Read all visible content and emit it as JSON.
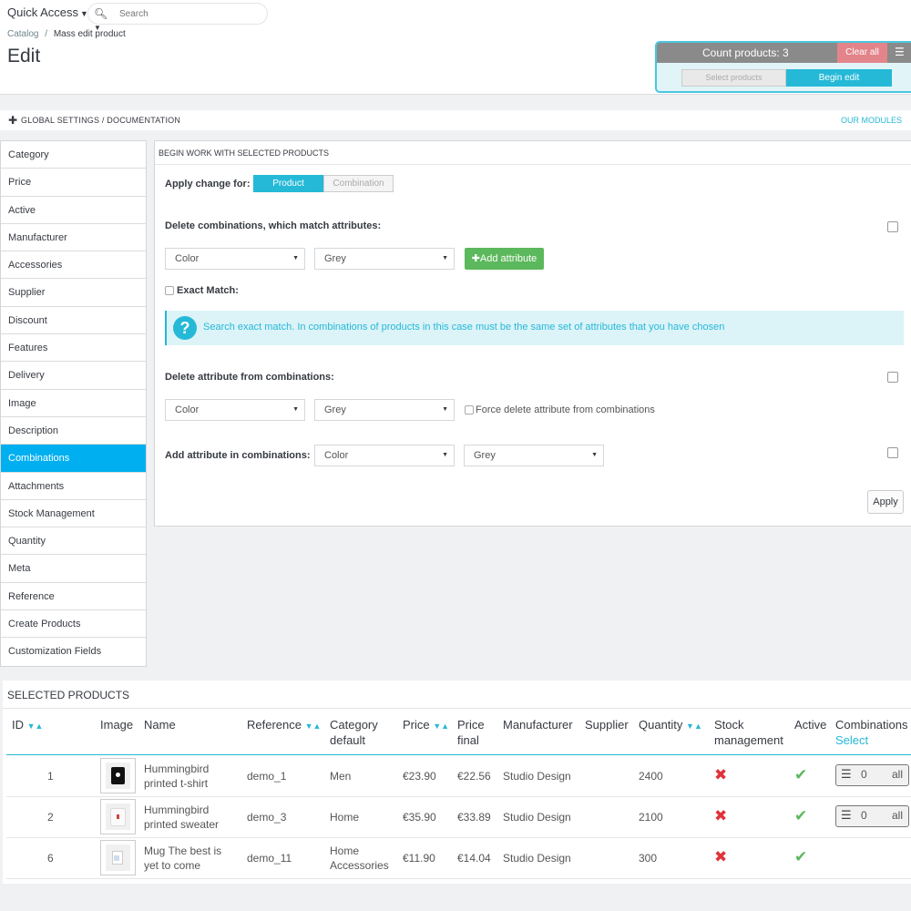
{
  "header": {
    "quick_access": "Quick Access",
    "search_placeholder": "Search",
    "breadcrumb": {
      "catalog": "Catalog",
      "sep": "/",
      "current": "Mass edit product"
    },
    "title": "Edit"
  },
  "count_panel": {
    "count_text": "Count products: 3",
    "clear_all": "Clear all",
    "select_products": "Select products",
    "begin_edit": "Begin edit"
  },
  "global_bar": {
    "label": "GLOBAL SETTINGS / DOCUMENTATION",
    "modules_link": "OUR MODULES"
  },
  "sidebar": {
    "items": [
      {
        "label": "Category"
      },
      {
        "label": "Price"
      },
      {
        "label": "Active"
      },
      {
        "label": "Manufacturer"
      },
      {
        "label": "Accessories"
      },
      {
        "label": "Supplier"
      },
      {
        "label": "Discount"
      },
      {
        "label": "Features"
      },
      {
        "label": "Delivery"
      },
      {
        "label": "Image"
      },
      {
        "label": "Description"
      },
      {
        "label": "Combinations"
      },
      {
        "label": "Attachments"
      },
      {
        "label": "Stock Management"
      },
      {
        "label": "Quantity"
      },
      {
        "label": "Meta"
      },
      {
        "label": "Reference"
      },
      {
        "label": "Create Products"
      },
      {
        "label": "Customization Fields"
      }
    ],
    "active": "Combinations"
  },
  "main": {
    "heading": "BEGIN WORK WITH SELECTED PRODUCTS",
    "apply_change_for": "Apply change for:",
    "toggle_product": "Product",
    "toggle_combination": "Combination",
    "delete_comb_label": "Delete combinations, which match attributes:",
    "select_attr_1": "Color",
    "select_val_1": "Grey",
    "add_attribute": "Add attribute",
    "exact_match": "Exact Match:",
    "info_text": "Search exact match. In combinations of products in this case must be the same set of attributes that you have chosen",
    "delete_attr_label": "Delete attribute from combinations:",
    "select_attr_2": "Color",
    "select_val_2": "Grey",
    "force_delete": "Force delete attribute from combinations",
    "add_attr_label": "Add attribute in combinations:",
    "select_attr_3": "Color",
    "select_val_3": "Grey",
    "apply": "Apply"
  },
  "selected_products": {
    "title": "SELECTED PRODUCTS",
    "columns": {
      "id": "ID",
      "image": "Image",
      "name": "Name",
      "reference": "Reference",
      "category_1": "Category",
      "category_2": "default",
      "price": "Price",
      "price_final_1": "Price",
      "price_final_2": "final",
      "manufacturer": "Manufacturer",
      "supplier": "Supplier",
      "quantity": "Quantity",
      "stock_1": "Stock",
      "stock_2": "management",
      "active": "Active",
      "combinations": "Combinations",
      "combinations_select": "Select"
    },
    "rows": [
      {
        "id": "1",
        "name_1": "Hummingbird",
        "name_2": "printed t-shirt",
        "reference": "demo_1",
        "category_1": "Men",
        "category_2": "",
        "price": "€23.90",
        "price_final": "€22.56",
        "manufacturer": "Studio Design",
        "quantity": "2400",
        "stock_management": false,
        "active": true,
        "comb_count": "0",
        "comb_all": "all"
      },
      {
        "id": "2",
        "name_1": "Hummingbird",
        "name_2": "printed sweater",
        "reference": "demo_3",
        "category_1": "Home",
        "category_2": "",
        "price": "€35.90",
        "price_final": "€33.89",
        "manufacturer": "Studio Design",
        "quantity": "2100",
        "stock_management": false,
        "active": true,
        "comb_count": "0",
        "comb_all": "all"
      },
      {
        "id": "6",
        "name_1": "Mug The best is",
        "name_2": "yet to come",
        "reference": "demo_11",
        "category_1": "Home",
        "category_2": "Accessories",
        "price": "€11.90",
        "price_final": "€14.04",
        "manufacturer": "Studio Design",
        "quantity": "300",
        "stock_management": false,
        "active": true
      }
    ]
  }
}
